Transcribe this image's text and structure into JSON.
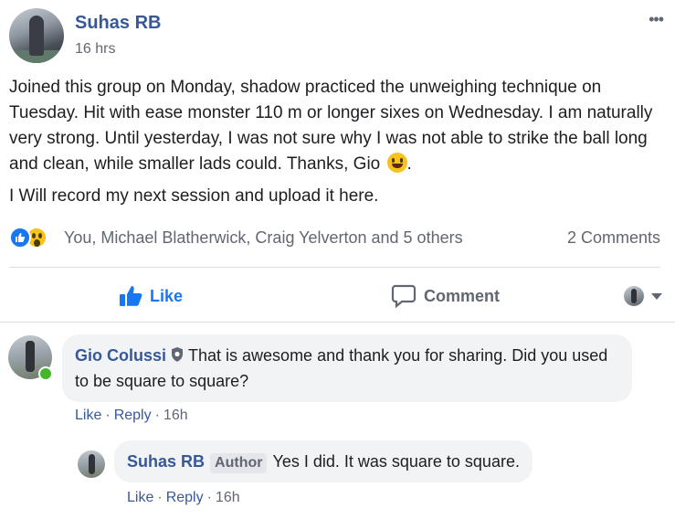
{
  "post": {
    "author": "Suhas RB",
    "time": "16 hrs",
    "more_label": "•••",
    "paragraphs": [
      "Joined this group on Monday, shadow practiced the unweighing technique on Tuesday. Hit with ease monster 110 m or longer sixes on Wednesday. I am naturally very strong. Until yesterday, I was not sure why I was not able to strike the ball long and clean, while smaller lads could. Thanks, Gio",
      "I Will record my next session and upload it here."
    ]
  },
  "reactions": {
    "icons": [
      "like-icon",
      "wow-icon"
    ],
    "names": "You, Michael Blatherwick, Craig Yelverton and 5 others",
    "comments_count": "2 Comments"
  },
  "actions": {
    "like": "Like",
    "comment": "Comment"
  },
  "comments": [
    {
      "author": "Gio Colussi",
      "text": "That is awesome and thank you for sharing. Did you used to be square to square?",
      "like": "Like",
      "reply": "Reply",
      "time": "16h",
      "online": true
    },
    {
      "author": "Suhas RB",
      "badge": "Author",
      "text": "Yes I did. It was square to square.",
      "like": "Like",
      "reply": "Reply",
      "time": "16h"
    }
  ],
  "colors": {
    "link_blue": "#365899",
    "like_blue": "#1877f2",
    "meta_gray": "#616770",
    "bubble_bg": "#f2f3f5",
    "online_green": "#42b72a"
  }
}
